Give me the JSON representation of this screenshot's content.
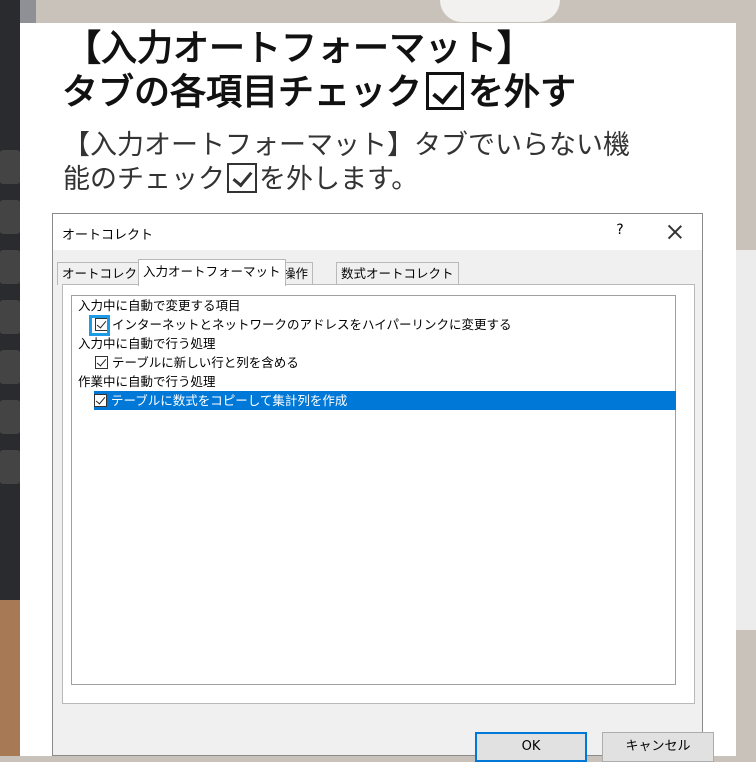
{
  "article": {
    "title_line1": "【入力オートフォーマット】",
    "title_line2_before": "タブの各項目チェック",
    "title_line2_after": "を外す",
    "subtitle_line1": "【入力オートフォーマット】タブでいらない機",
    "subtitle_line2_before": "能のチェック",
    "subtitle_line2_after": "を外します。"
  },
  "dialog": {
    "title": "オートコレクト",
    "help_label": "?",
    "tabs": [
      {
        "label": "オートコレクト",
        "active": false
      },
      {
        "label": "入力オートフォーマット",
        "active": true
      },
      {
        "label": "操作",
        "active": false
      },
      {
        "label": "数式オートコレクト",
        "active": false
      }
    ],
    "groups": [
      {
        "heading": "入力中に自動で変更する項目",
        "items": [
          {
            "label": "インターネットとネットワークのアドレスをハイパーリンクに変更する",
            "checked": true,
            "selected": false
          }
        ]
      },
      {
        "heading": "入力中に自動で行う処理",
        "items": [
          {
            "label": "テーブルに新しい行と列を含める",
            "checked": true,
            "selected": false
          }
        ]
      },
      {
        "heading": "作業中に自動で行う処理",
        "items": [
          {
            "label": "テーブルに数式をコピーして集計列を作成",
            "checked": true,
            "selected": true
          }
        ]
      }
    ],
    "ok_label": "OK",
    "cancel_label": "キャンセル"
  },
  "colors": {
    "selection": "#0078d7",
    "highlight_box": "#1e9be6"
  }
}
